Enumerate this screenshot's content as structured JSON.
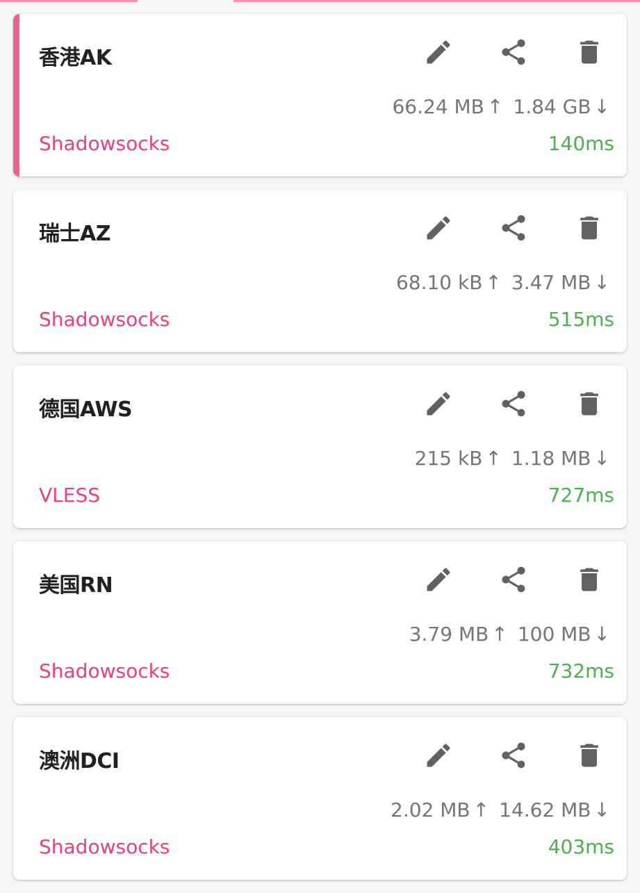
{
  "colors": {
    "accent": "#f06292",
    "protocol": "#ec407a",
    "latency": "#4caf50",
    "icon": "#616161",
    "traffic": "#757575"
  },
  "icons": {
    "edit": "pencil-icon",
    "share": "share-icon",
    "delete": "trash-icon"
  },
  "profiles": [
    {
      "name": "香港AK",
      "upload": "66.24 MB",
      "download": "1.84 GB",
      "up_arrow": "↑",
      "down_arrow": "↓",
      "protocol": "Shadowsocks",
      "latency": "140ms",
      "selected": true
    },
    {
      "name": "瑞士AZ",
      "upload": "68.10 kB",
      "download": "3.47 MB",
      "up_arrow": "↑",
      "down_arrow": "↓",
      "protocol": "Shadowsocks",
      "latency": "515ms",
      "selected": false
    },
    {
      "name": "德国AWS",
      "upload": "215 kB",
      "download": "1.18 MB",
      "up_arrow": "↑",
      "down_arrow": "↓",
      "protocol": "VLESS",
      "latency": "727ms",
      "selected": false
    },
    {
      "name": "美国RN",
      "upload": "3.79 MB",
      "download": "100 MB",
      "up_arrow": "↑",
      "down_arrow": "↓",
      "protocol": "Shadowsocks",
      "latency": "732ms",
      "selected": false
    },
    {
      "name": "澳洲DCI",
      "upload": "2.02 MB",
      "download": "14.62 MB",
      "up_arrow": "↑",
      "down_arrow": "↓",
      "protocol": "Shadowsocks",
      "latency": "403ms",
      "selected": false
    }
  ]
}
